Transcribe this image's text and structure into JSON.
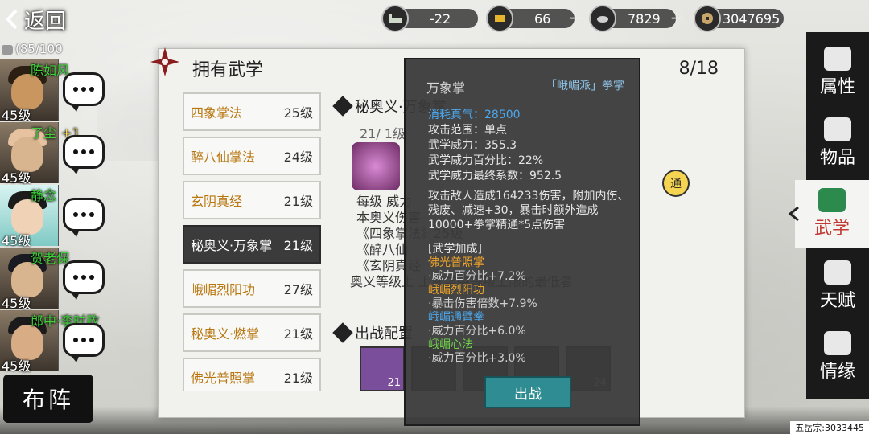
{
  "topbar": {
    "back_label": "返回",
    "resources": [
      {
        "icon": "bed-icon",
        "value": "-22"
      },
      {
        "icon": "gold-ingot-icon",
        "value": "66"
      },
      {
        "icon": "silver-ingot-icon",
        "value": "7829"
      },
      {
        "icon": "coin-icon",
        "value": "3047695"
      }
    ]
  },
  "left": {
    "stamina": "(85/100",
    "characters": [
      {
        "name": "陈如风",
        "level": "45级",
        "badge": ""
      },
      {
        "name": "了尘",
        "level": "45级",
        "badge": "+1"
      },
      {
        "name": "静念",
        "level": "45级",
        "badge": ""
      },
      {
        "name": "贺老保",
        "level": "45级",
        "badge": ""
      },
      {
        "name": "郎中·李时政",
        "level": "45级",
        "badge": ""
      }
    ],
    "formation_label": "布阵"
  },
  "main": {
    "title": "拥有武学",
    "count": "8/18",
    "skills": [
      {
        "name": "四象掌法",
        "level": "25级"
      },
      {
        "name": "醉八仙掌法",
        "level": "24级"
      },
      {
        "name": "玄阴真经",
        "level": "21级"
      },
      {
        "name": "秘奥义·万象掌",
        "level": "21级"
      },
      {
        "name": "峨嵋烈阳功",
        "level": "27级"
      },
      {
        "name": "秘奥义·燃掌",
        "level": "21级"
      },
      {
        "name": "佛光普照掌",
        "level": "21级"
      }
    ],
    "detail": {
      "heading": "秘奥义·万象掌",
      "sub": "21/ 1级",
      "lines": [
        "每级  威力",
        "本奥义伤害",
        "《四象掌法》25级",
        "《醉八仙",
        "《玄阴真经",
        "奥义等级上                上武学中等级上限的最低者"
      ],
      "tong": "通",
      "outfit_label": "出战配置",
      "slots": [
        "21",
        "",
        "",
        "",
        "24"
      ]
    }
  },
  "tooltip": {
    "name": "万象掌",
    "sect": "「峨嵋派」拳掌",
    "stats": [
      {
        "text": "消耗真气：28500",
        "style": "blue"
      },
      {
        "text": "攻击范围：单点",
        "style": ""
      },
      {
        "text": "武学威力：355.3",
        "style": ""
      },
      {
        "text": "武学威力百分比：22%",
        "style": ""
      },
      {
        "text": "武学威力最终系数：952.5",
        "style": ""
      }
    ],
    "desc": "攻击敌人造成164233伤害，附加内伤、残废、减速+30，暴击时额外造成10000+拳掌精通*5点伤害",
    "bonus_title": "[武学加成]",
    "bonus": [
      {
        "text": "佛光普照掌",
        "style": "o"
      },
      {
        "text": "·威力百分比+7.2%",
        "style": "l"
      },
      {
        "text": "峨嵋烈阳功",
        "style": "o"
      },
      {
        "text": "·暴击伤害倍数+7.9%",
        "style": "l"
      },
      {
        "text": "峨嵋通臂拳",
        "style": "b"
      },
      {
        "text": "·威力百分比+6.0%",
        "style": "l"
      },
      {
        "text": "峨嵋心法",
        "style": "g"
      },
      {
        "text": "·威力百分比+3.0%",
        "style": "l"
      }
    ],
    "go_label": "出战"
  },
  "rightmenu": [
    {
      "label": "属性",
      "icon": "profile-icon"
    },
    {
      "label": "物品",
      "icon": "box-icon"
    },
    {
      "label": "武学",
      "icon": "book-icon",
      "selected": true
    },
    {
      "label": "天赋",
      "icon": "talent-icon"
    },
    {
      "label": "情缘",
      "icon": "heart-icon"
    }
  ],
  "footer": "五岳宗:3033445"
}
